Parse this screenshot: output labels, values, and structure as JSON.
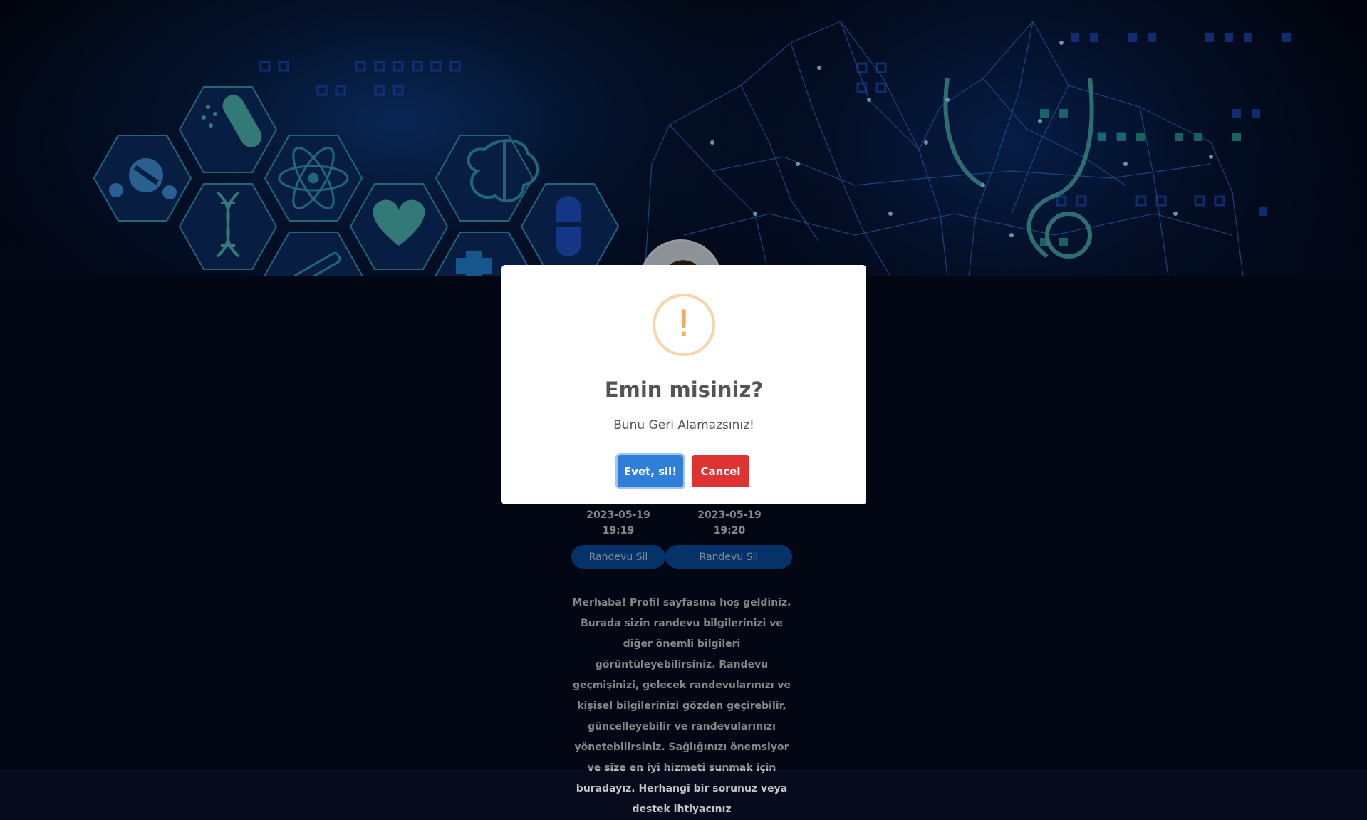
{
  "appointments": [
    {
      "date": "2023-05-19",
      "time": "19:19",
      "delete_label": "Randevu Sil"
    },
    {
      "date": "2023-05-19",
      "time": "19:20",
      "delete_label": "Randevu Sil"
    }
  ],
  "intro_text": "Merhaba! Profil sayfasına hoş geldiniz. Burada sizin randevu bilgilerinizi ve diğer önemli bilgileri görüntüleyebilirsiniz. Randevu geçmişinizi, gelecek randevularınızı ve kişisel bilgilerinizi gözden geçirebilir, güncelleyebilir ve randevularınızı yönetebilirsiniz. Sağlığınızı önemsiyor ve size en iyi hizmeti sunmak için buradayız. Herhangi bir sorunuz veya destek ihtiyacınız",
  "dialog": {
    "icon": "warning-icon",
    "icon_glyph": "!",
    "title": "Emin misiniz?",
    "text": "Bunu Geri Alamazsınız!",
    "confirm_label": "Evet, sil!",
    "cancel_label": "Cancel"
  },
  "colors": {
    "confirm": "#2f7fd8",
    "cancel": "#dd3333",
    "warning": "#f6a95f",
    "appointment_button": "#0a4a9c",
    "page_background": "#050b1c"
  }
}
